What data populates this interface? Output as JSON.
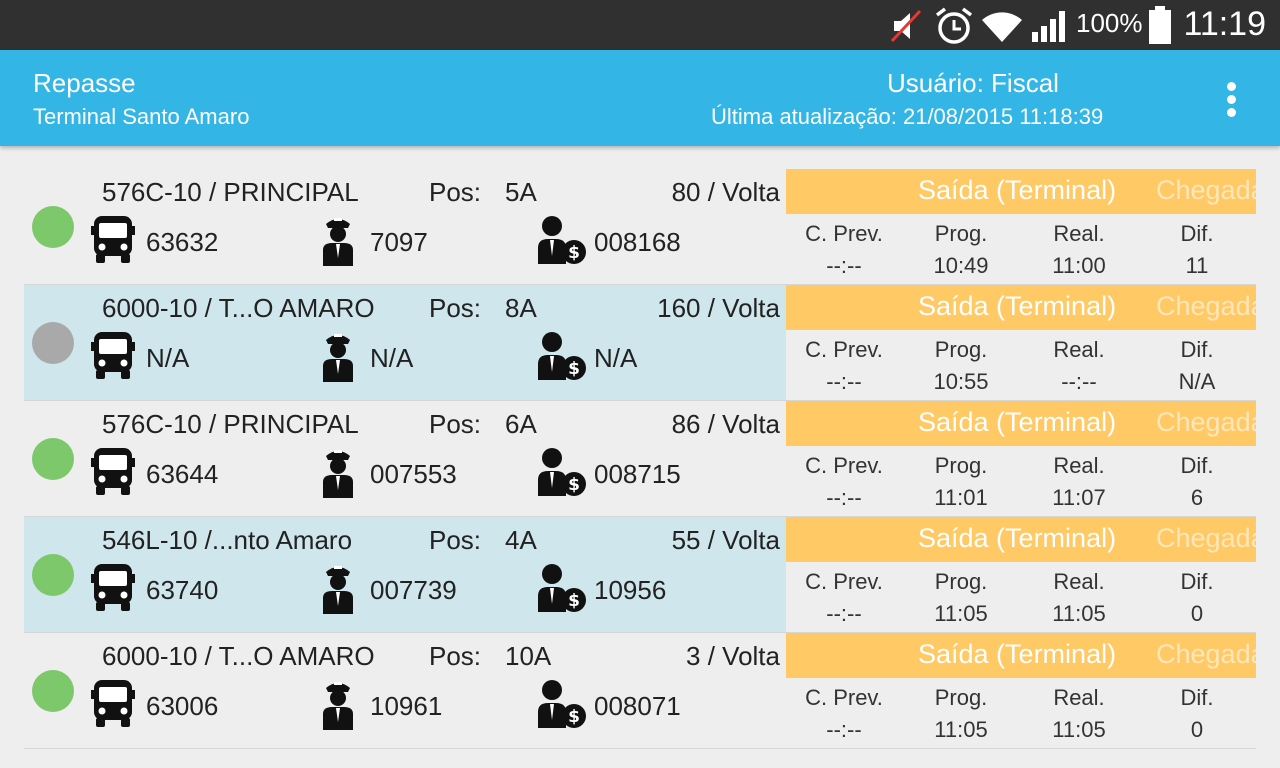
{
  "status_bar": {
    "icons": [
      "mute-icon",
      "alarm-icon",
      "wifi-icon",
      "signal-icon",
      "battery-icon"
    ],
    "battery": "100%",
    "time": "11:19"
  },
  "header": {
    "title": "Repasse",
    "subtitle": "Terminal Santo Amaro",
    "user": "Usuário: Fiscal",
    "last_update": "Última atualização: 21/08/2015 11:18:39",
    "menu_icon": "overflow-menu-icon"
  },
  "colors": {
    "status_bar": "#303030",
    "action_bar": "#33b5e5",
    "panel_header": "#ffc966",
    "row_alt": "#cfe6ec",
    "status_green": "#7dc86a",
    "status_gray": "#a9a9a9"
  },
  "labels": {
    "pos": "Pos:",
    "out_header": "Saída (Terminal)",
    "in_header": "Chegada",
    "col_prev": "C. Prev.",
    "col_prog": "Prog.",
    "col_real": "Real.",
    "col_dif": "Dif."
  },
  "rows": [
    {
      "status": "green",
      "route": "576C-10 / PRINCIPAL",
      "pos": "5A",
      "trip": "80 / Volta",
      "bus": "63632",
      "driver": "7097",
      "collector": "008168",
      "prev": "--:--",
      "prog": "10:49",
      "real": "11:00",
      "dif": "11"
    },
    {
      "status": "gray",
      "route": "6000-10 / T...O AMARO",
      "pos": "8A",
      "trip": "160 / Volta",
      "bus": "N/A",
      "driver": "N/A",
      "collector": "N/A",
      "prev": "--:--",
      "prog": "10:55",
      "real": "--:--",
      "dif": "N/A"
    },
    {
      "status": "green",
      "route": "576C-10 / PRINCIPAL",
      "pos": "6A",
      "trip": "86 / Volta",
      "bus": "63644",
      "driver": "007553",
      "collector": "008715",
      "prev": "--:--",
      "prog": "11:01",
      "real": "11:07",
      "dif": "6"
    },
    {
      "status": "green",
      "route": "546L-10 /...nto Amaro",
      "pos": "4A",
      "trip": "55 / Volta",
      "bus": "63740",
      "driver": "007739",
      "collector": "10956",
      "prev": "--:--",
      "prog": "11:05",
      "real": "11:05",
      "dif": "0"
    },
    {
      "status": "green",
      "route": "6000-10 / T...O AMARO",
      "pos": "10A",
      "trip": "3 / Volta",
      "bus": "63006",
      "driver": "10961",
      "collector": "008071",
      "prev": "--:--",
      "prog": "11:05",
      "real": "11:05",
      "dif": "0"
    }
  ]
}
